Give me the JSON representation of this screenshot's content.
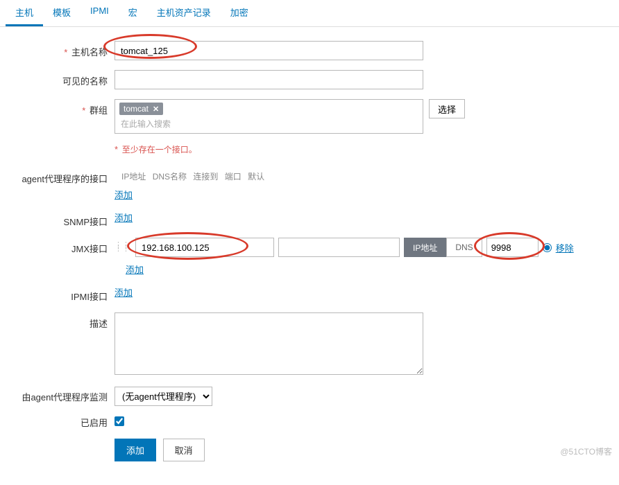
{
  "tabs": {
    "host": "主机",
    "template": "模板",
    "ipmi": "IPMI",
    "macro": "宏",
    "inventory": "主机资产记录",
    "encryption": "加密"
  },
  "labels": {
    "hostname": "主机名称",
    "visiblename": "可见的名称",
    "groups": "群组",
    "agent_if": "agent代理程序的接口",
    "snmp_if": "SNMP接口",
    "jmx_if": "JMX接口",
    "ipmi_if": "IPMI接口",
    "description": "描述",
    "monitored_by": "由agent代理程序监测",
    "enabled": "已启用"
  },
  "values": {
    "hostname": "tomcat_125",
    "visiblename": "",
    "group_tag": "tomcat",
    "jmx_ip": "192.168.100.125",
    "jmx_dns": "",
    "jmx_port": "9998",
    "description": "",
    "monitored_by": "(无agent代理程序)",
    "enabled": true
  },
  "placeholders": {
    "group_search": "在此输入搜索"
  },
  "iface_header": {
    "ip": "IP地址",
    "dns": "DNS名称",
    "connect": "连接到",
    "port": "端口",
    "default": "默认"
  },
  "toggle": {
    "ip": "IP地址",
    "dns": "DNS"
  },
  "links": {
    "add": "添加",
    "remove": "移除",
    "select": "选择"
  },
  "errors": {
    "no_interface": "至少存在一个接口。"
  },
  "buttons": {
    "submit": "添加",
    "cancel": "取消"
  },
  "watermark": "@51CTO博客"
}
